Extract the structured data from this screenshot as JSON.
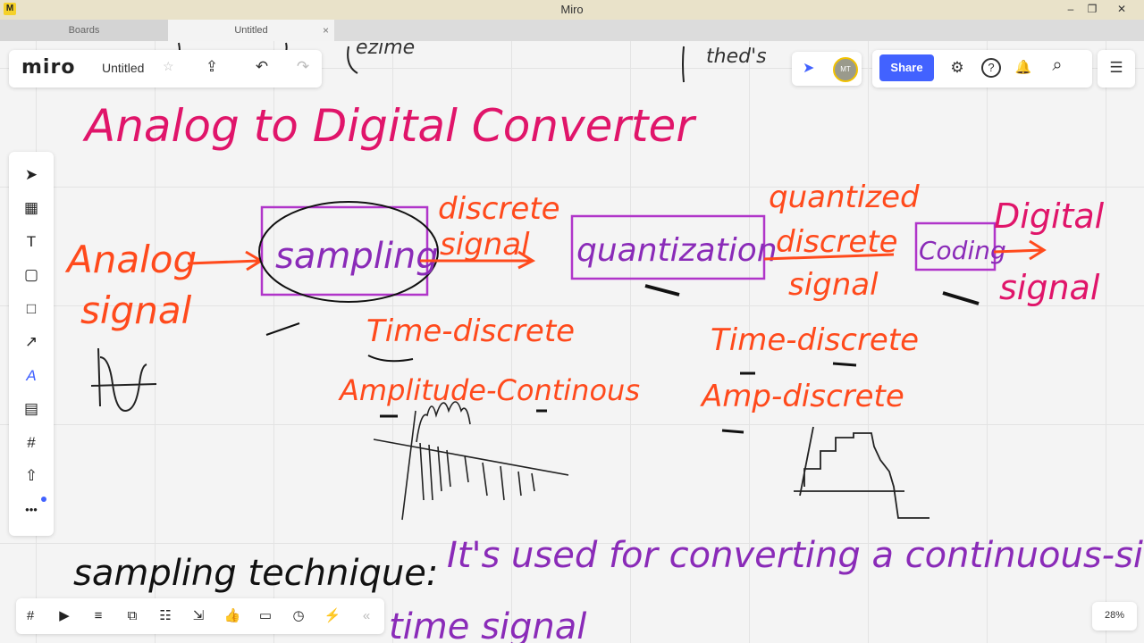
{
  "window": {
    "title": "Miro",
    "minimize": "‒",
    "maximize": "❐",
    "close": "✕",
    "app_icon": "M"
  },
  "tabs": [
    {
      "label": "Boards"
    },
    {
      "label": "Untitled",
      "close": "×"
    }
  ],
  "header": {
    "logo": "miro",
    "board_name": "Untitled",
    "star": "☆",
    "export_icon": "⇪",
    "undo_icon": "↶",
    "redo_icon": "↷"
  },
  "collab": {
    "avatar_initials": "MT",
    "cursor_icon": "➤"
  },
  "right_toolbar": {
    "share_label": "Share",
    "settings_icon": "⚙",
    "help_icon": "?",
    "notifications_icon": "🔔",
    "search_icon": "⌕",
    "menu_icon": "☰"
  },
  "tools": [
    {
      "icon": "➤",
      "name": "select-tool"
    },
    {
      "icon": "▦",
      "name": "templates-tool"
    },
    {
      "icon": "T",
      "name": "text-tool"
    },
    {
      "icon": "▢",
      "name": "sticky-note-tool"
    },
    {
      "icon": "□",
      "name": "shape-tool"
    },
    {
      "icon": "↗",
      "name": "connection-line-tool"
    },
    {
      "icon": "A",
      "name": "pen-tool"
    },
    {
      "icon": "▤",
      "name": "comment-tool"
    },
    {
      "icon": "#",
      "name": "frame-tool"
    },
    {
      "icon": "⇧",
      "name": "upload-tool"
    },
    {
      "icon": "•••",
      "name": "more-tools"
    }
  ],
  "bottom_tools": [
    "#",
    "▶",
    "≡",
    "⧉",
    "☷",
    "⇲",
    "👍",
    "▭",
    "◷",
    "⚡",
    "«"
  ],
  "zoom": "28%",
  "handwriting": {
    "title": "Analog to Digital Converter",
    "analog_signal_1": "Analog",
    "analog_signal_2": "signal",
    "sampling": "sampling",
    "discrete_1": "discrete",
    "discrete_2": "signal",
    "quantization": "quantization",
    "quantized_1": "quantized",
    "quantized_2": "discrete",
    "quantized_3": "signal",
    "coding": "Coding",
    "digital_1": "Digital",
    "digital_2": "signal",
    "time_discrete_1": "Time-discrete",
    "amp_continuous": "Amplitude-Continous",
    "time_discrete_2": "Time-discrete",
    "amp_discrete": "Amp-discrete",
    "sampling_technique": "sampling technique:",
    "usage": "It's used for converting a continuous-signal",
    "usage_2": "time signal"
  }
}
